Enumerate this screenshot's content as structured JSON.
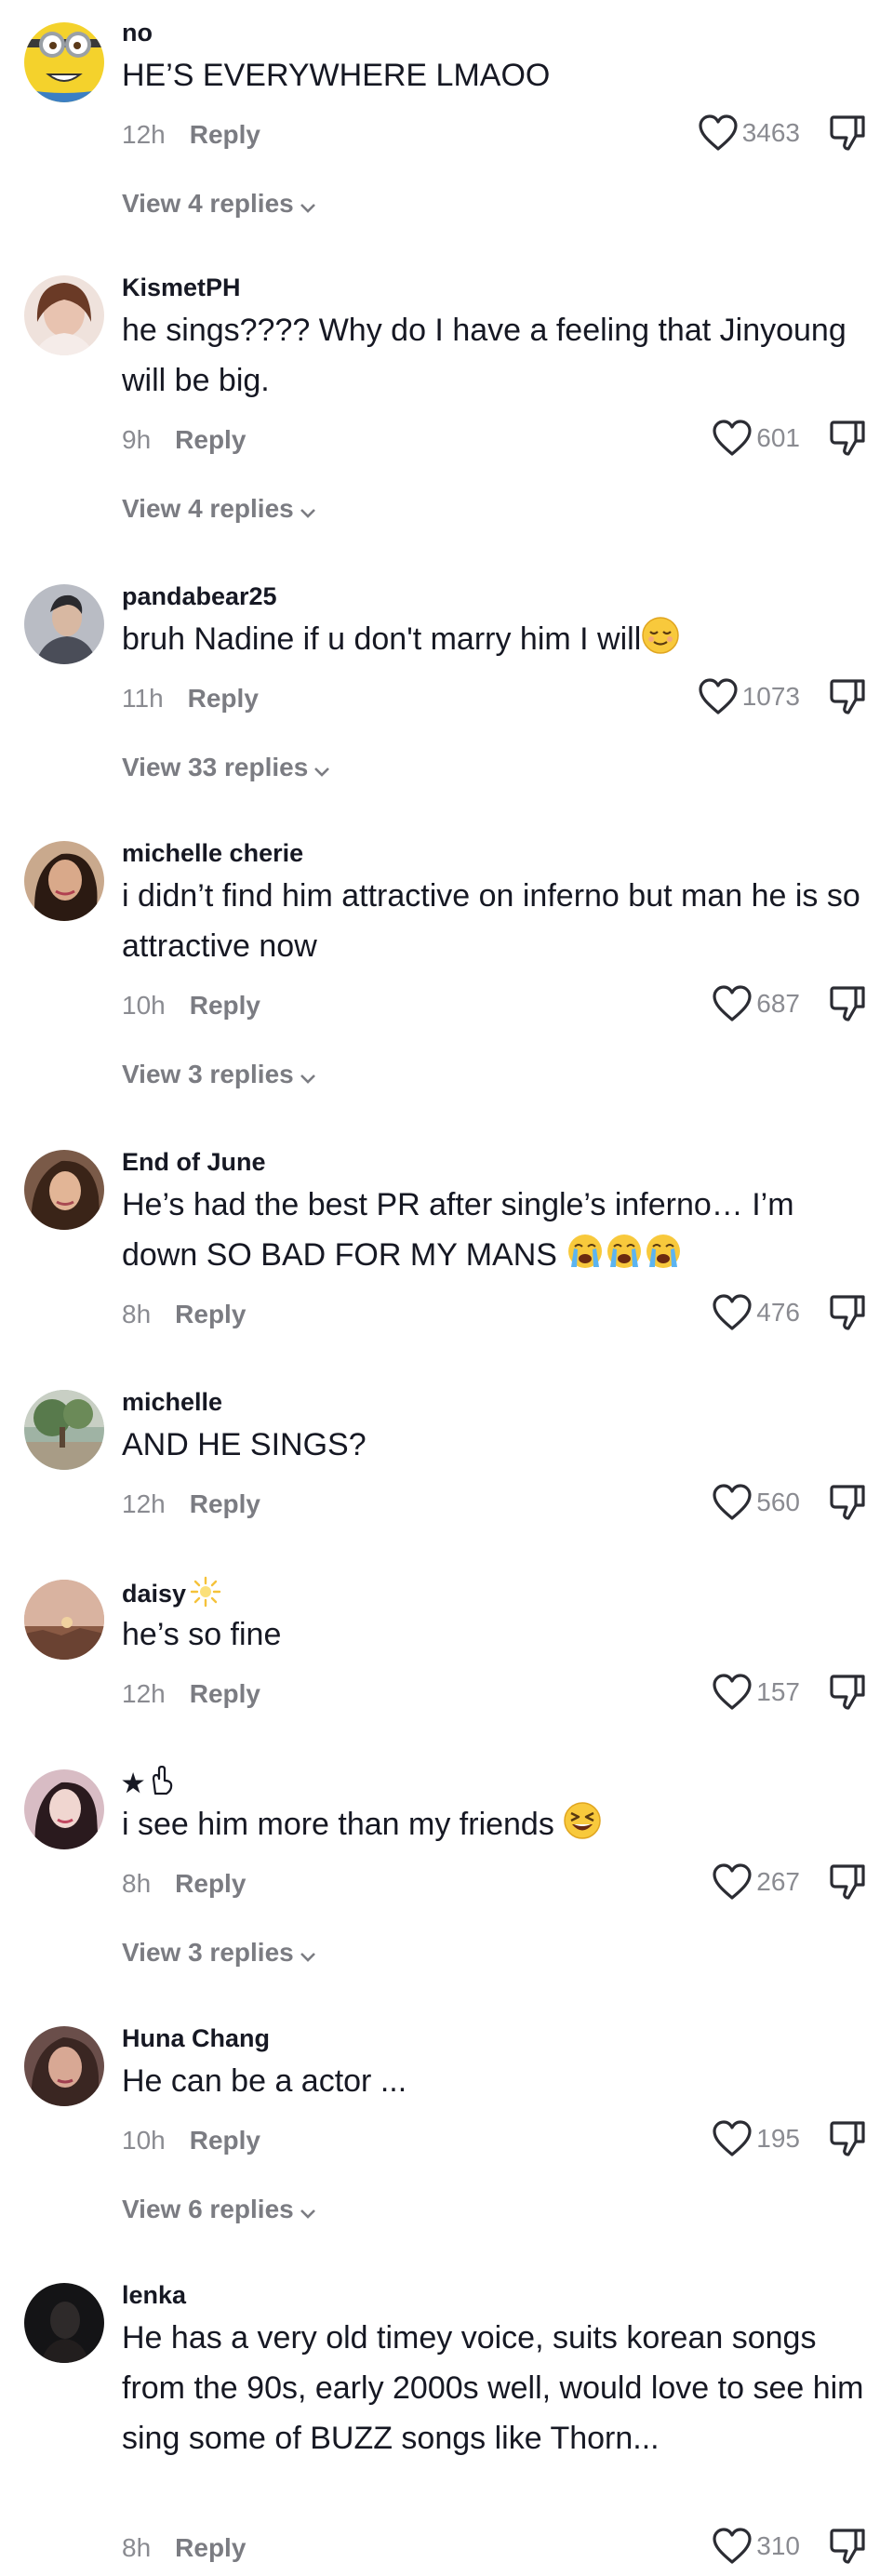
{
  "colors": {
    "text": "#161823",
    "secondary": "#8a8b91",
    "reply": "#7b7c82",
    "icon": "#2b2c33"
  },
  "comments": [
    {
      "username": "no",
      "text": "HE’S EVERYWHERE LMAOO",
      "time": "12h",
      "reply_label": "Reply",
      "likes": "3463",
      "view_replies": "View 4 replies",
      "avatar": "minion-avatar"
    },
    {
      "username": "KismetPH",
      "text": "he sings???? Why do I have a feeling that Jinyoung will be big.",
      "time": "9h",
      "reply_label": "Reply",
      "likes": "601",
      "view_replies": "View 4 replies",
      "avatar": "photo-avatar"
    },
    {
      "username": "pandabear25",
      "text": "bruh Nadine if u don't marry him I will",
      "emoji": "relieved-face-emoji",
      "time": "11h",
      "reply_label": "Reply",
      "likes": "1073",
      "view_replies": "View 33 replies",
      "avatar": "photo-avatar"
    },
    {
      "username": "michelle cherie",
      "text": "i didn’t find him attractive on inferno but man he is so attractive now",
      "time": "10h",
      "reply_label": "Reply",
      "likes": "687",
      "view_replies": "View 3 replies",
      "avatar": "photo-avatar"
    },
    {
      "username": "End of June",
      "text": "He’s had the best PR after single’s inferno… I’m down SO BAD FOR MY MANS",
      "emoji": "loudly-crying-face-emoji-x3",
      "time": "8h",
      "reply_label": "Reply",
      "likes": "476",
      "avatar": "photo-avatar"
    },
    {
      "username": "michelle",
      "text": "AND HE SINGS?",
      "time": "12h",
      "reply_label": "Reply",
      "likes": "560",
      "avatar": "landscape-avatar"
    },
    {
      "username": "daisy",
      "username_icon": "sun-icon",
      "text": "he’s so fine",
      "time": "12h",
      "reply_label": "Reply",
      "likes": "157",
      "avatar": "sunset-avatar"
    },
    {
      "username": "★",
      "username_icon": "hand-icon",
      "text": "i see him more than my friends",
      "emoji": "grinning-squinting-face-emoji",
      "time": "8h",
      "reply_label": "Reply",
      "likes": "267",
      "view_replies": "View 3 replies",
      "avatar": "photo-avatar"
    },
    {
      "username": "Huna Chang",
      "text": "He can be a actor ...",
      "time": "10h",
      "reply_label": "Reply",
      "likes": "195",
      "view_replies": "View 6 replies",
      "avatar": "photo-avatar"
    },
    {
      "username": "lenka",
      "text": "He has a very old timey voice, suits korean songs from the 90s, early 2000s well, would love to see him sing some of BUZZ songs like Thorn...",
      "time": "8h",
      "reply_label": "Reply",
      "likes": "310",
      "avatar": "dark-photo-avatar"
    }
  ]
}
